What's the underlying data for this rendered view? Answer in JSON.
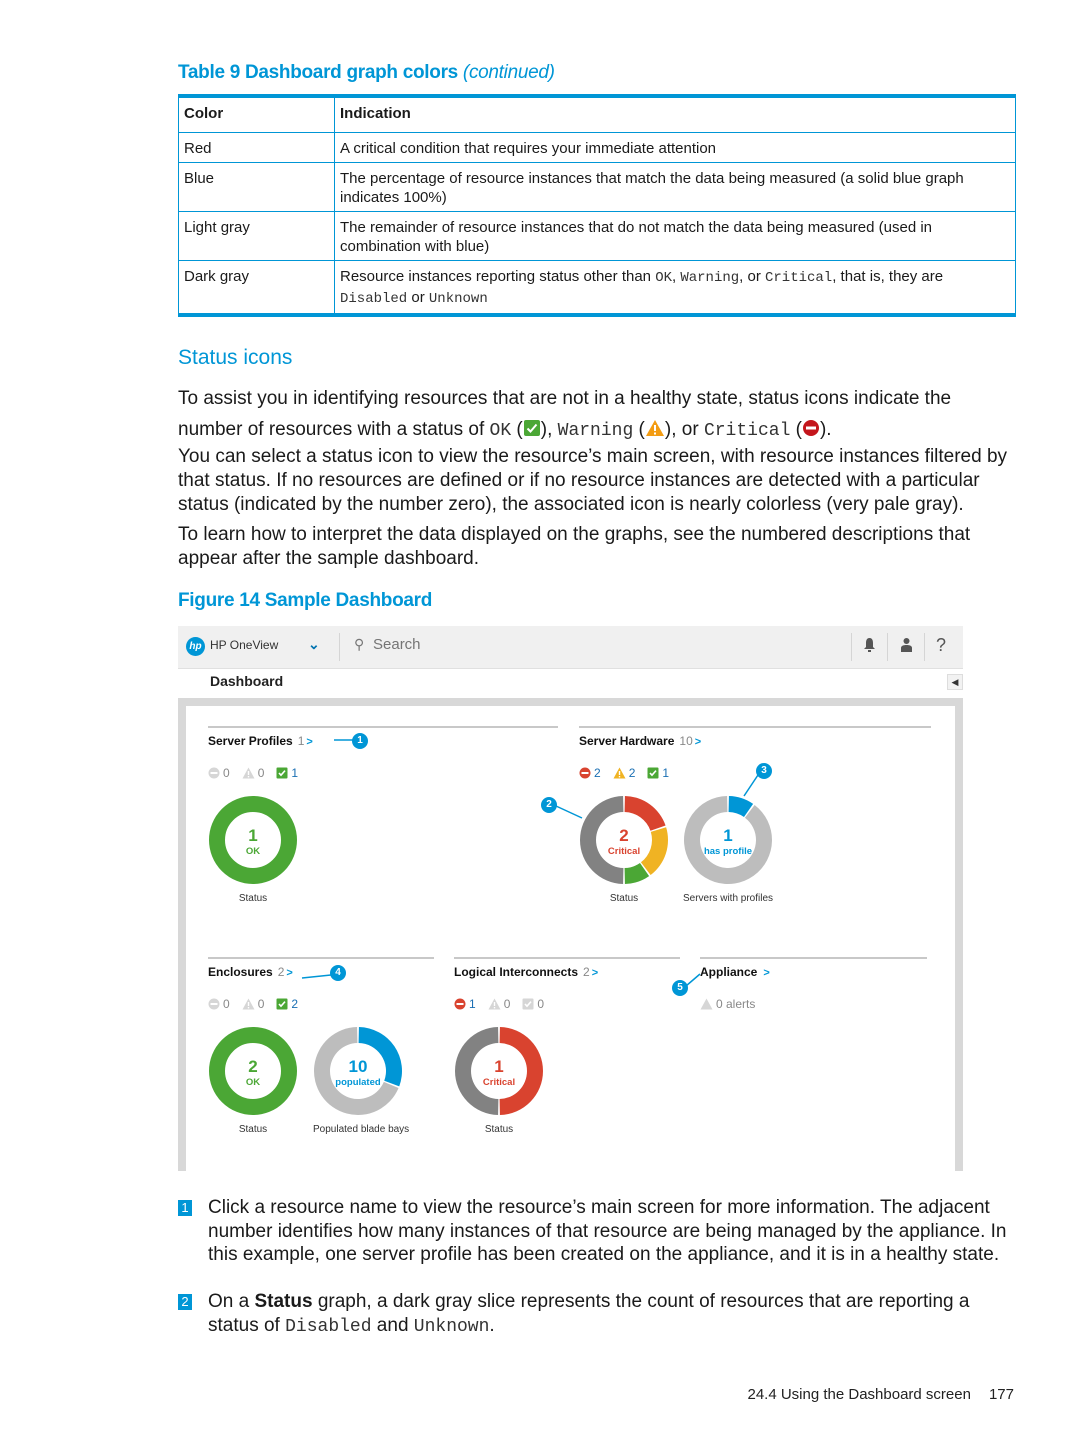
{
  "table": {
    "caption_prefix": "Table 9 Dashboard graph colors",
    "caption_suffix": "(continued)",
    "headers": [
      "Color",
      "Indication"
    ],
    "rows": [
      {
        "color": "Red",
        "indication": "A critical condition that requires your immediate attention"
      },
      {
        "color": "Blue",
        "indication": "The percentage of resource instances that match the data being measured (a solid blue graph indicates 100%)"
      },
      {
        "color": "Light gray",
        "indication": "The remainder of resource instances that do not match the data being measured (used in combination with blue)"
      },
      {
        "color": "Dark gray",
        "indication_parts": [
          "Resource instances reporting status other than ",
          "OK",
          ", ",
          "Warning",
          ", or ",
          "Critical",
          ", that is, they are ",
          "Disabled",
          " or ",
          "Unknown"
        ]
      }
    ]
  },
  "section": {
    "heading": "Status icons",
    "p1_parts": [
      "To assist you in identifying resources that are not in a healthy state, status icons indicate the number of resources with a status of ",
      "OK",
      " (",
      "), ",
      "Warning",
      " (",
      "), or ",
      "Critical",
      " (",
      ")."
    ],
    "p2": "You can select a status icon to view the resource’s main screen, with resource instances filtered by that status. If no resources are defined or if no resource instances are detected with a particular status (indicated by the number zero), the associated icon is nearly colorless (very pale gray).",
    "p3": "To learn how to interpret the data displayed on the graphs, see the numbered descriptions that appear after the sample dashboard."
  },
  "figure": {
    "caption": "Figure 14 Sample Dashboard"
  },
  "dashboard": {
    "app_name": "HP OneView",
    "logo_text": "hp",
    "search_placeholder": "Search",
    "page_title": "Dashboard",
    "colors": {
      "red": "#d9432f",
      "yellow": "#f0b323",
      "green": "#4ba735",
      "blue": "#0096d6",
      "dark_gray": "#828282",
      "light_gray": "#bdbdbd"
    },
    "widgets": {
      "server_profiles": {
        "name": "Server Profiles",
        "count": "1",
        "critical": "0",
        "warning": "0",
        "ok": "1",
        "donuts": [
          {
            "value": "1",
            "label": "OK",
            "caption": "Status",
            "type": "status",
            "segments": {
              "critical": 0,
              "warning": 0,
              "ok": 1,
              "other": 0
            }
          }
        ]
      },
      "server_hardware": {
        "name": "Server Hardware",
        "count": "10",
        "critical": "2",
        "warning": "2",
        "ok": "1",
        "donuts": [
          {
            "value": "2",
            "label": "Critical",
            "caption": "Status",
            "type": "status",
            "segments": {
              "critical": 2,
              "warning": 2,
              "ok": 1,
              "other": 5
            }
          },
          {
            "value": "1",
            "label": "has profile",
            "caption": "Servers with profiles",
            "type": "percent",
            "fraction": 0.1
          }
        ]
      },
      "enclosures": {
        "name": "Enclosures",
        "count": "2",
        "critical": "0",
        "warning": "0",
        "ok": "2",
        "donuts": [
          {
            "value": "2",
            "label": "OK",
            "caption": "Status",
            "type": "status",
            "segments": {
              "critical": 0,
              "warning": 0,
              "ok": 2,
              "other": 0
            }
          },
          {
            "value": "10",
            "label": "populated",
            "caption": "Populated blade bays",
            "type": "percent",
            "fraction": 0.31
          }
        ]
      },
      "logical_interconnects": {
        "name": "Logical Interconnects",
        "count": "2",
        "critical": "1",
        "warning": "0",
        "ok": "0",
        "donuts": [
          {
            "value": "1",
            "label": "Critical",
            "caption": "Status",
            "type": "status",
            "segments": {
              "critical": 1,
              "warning": 0,
              "ok": 0,
              "other": 1
            }
          }
        ]
      },
      "appliance": {
        "name": "Appliance",
        "alerts": "0 alerts"
      }
    },
    "callouts": [
      "1",
      "2",
      "3",
      "4",
      "5"
    ]
  },
  "notes": [
    {
      "num": "1",
      "text": "Click a resource name to view the resource’s main screen for more information. The adjacent number identifies how many instances of that resource are being managed by the appliance. In this example, one server profile has been created on the appliance, and it is in a healthy state."
    },
    {
      "num": "2",
      "parts": [
        "On a ",
        "Status",
        " graph, a dark gray slice represents the count of resources that are reporting a status of ",
        "Disabled",
        " and ",
        "Unknown",
        "."
      ]
    }
  ],
  "footer": {
    "section": "24.4 Using the Dashboard screen",
    "page": "177"
  }
}
